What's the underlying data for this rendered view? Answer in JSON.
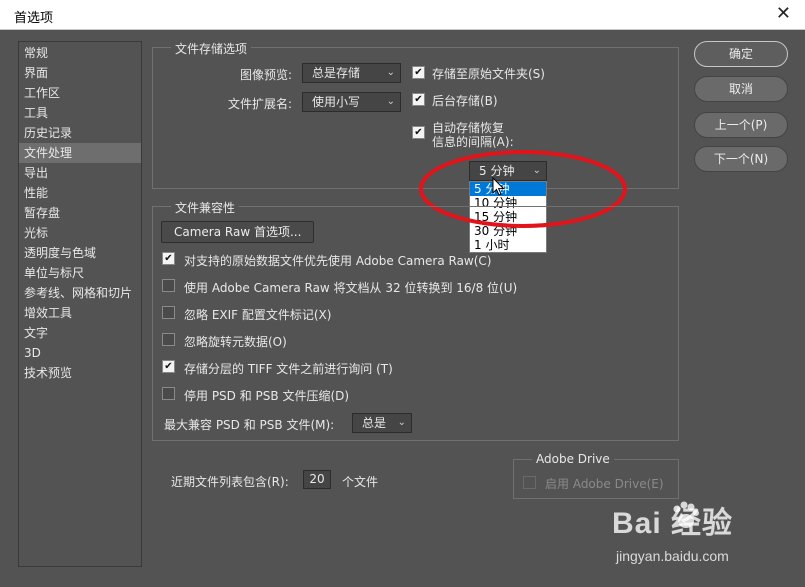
{
  "window": {
    "title": "首选项",
    "close_glyph": "✕"
  },
  "sidebar": {
    "items": [
      {
        "label": "常规"
      },
      {
        "label": "界面"
      },
      {
        "label": "工作区"
      },
      {
        "label": "工具"
      },
      {
        "label": "历史记录"
      },
      {
        "label": "文件处理",
        "active": true
      },
      {
        "label": "导出"
      },
      {
        "label": "性能"
      },
      {
        "label": "暂存盘"
      },
      {
        "label": "光标"
      },
      {
        "label": "透明度与色域"
      },
      {
        "label": "单位与标尺"
      },
      {
        "label": "参考线、网格和切片"
      },
      {
        "label": "增效工具"
      },
      {
        "label": "文字"
      },
      {
        "label": "3D"
      },
      {
        "label": "技术预览"
      }
    ]
  },
  "file_saving": {
    "title": "文件存储选项",
    "image_preview_label": "图像预览:",
    "image_preview_value": "总是存储",
    "file_ext_label": "文件扩展名:",
    "file_ext_value": "使用小写",
    "save_to_original": {
      "label": "存储至原始文件夹(S)",
      "checked": true
    },
    "background_save": {
      "label": "后台存储(B)",
      "checked": true
    },
    "autosave": {
      "label_line1": "自动存储恢复",
      "label_line2": "信息的间隔(A):",
      "checked": true
    },
    "interval_value": "5 分钟",
    "interval_options": [
      "5 分钟",
      "10 分钟",
      "15 分钟",
      "30 分钟",
      "1 小时"
    ]
  },
  "compat": {
    "title": "文件兼容性",
    "camera_raw_button": "Camera Raw 首选项...",
    "options": [
      {
        "label": "对支持的原始数据文件优先使用 Adobe Camera Raw(C)",
        "checked": true
      },
      {
        "label": "使用 Adobe Camera Raw 将文档从 32 位转换到 16/8 位(U)",
        "checked": false
      },
      {
        "label": "忽略 EXIF 配置文件标记(X)",
        "checked": false
      },
      {
        "label": "忽略旋转元数据(O)",
        "checked": false
      },
      {
        "label": "存储分层的 TIFF 文件之前进行询问 (T)",
        "checked": true
      },
      {
        "label": "停用 PSD 和 PSB 文件压缩(D)",
        "checked": false
      }
    ],
    "max_compat_label": "最大兼容 PSD 和 PSB 文件(M):",
    "max_compat_value": "总是"
  },
  "recent": {
    "label": "近期文件列表包含(R):",
    "value": "20",
    "suffix": "个文件"
  },
  "adobe_drive": {
    "title": "Adobe Drive",
    "option_label": "启用 Adobe Drive(E)",
    "checked": false
  },
  "buttons": {
    "ok": "确定",
    "cancel": "取消",
    "prev": "上一个(P)",
    "next": "下一个(N)"
  },
  "watermark": {
    "brand": "Bai 经验",
    "url": "jingyan.baidu.com"
  },
  "colors": {
    "accent": "#0078d7",
    "annotation_ring": "#e0141a",
    "dialog_bg": "#535353"
  },
  "icons": {
    "close": "close-icon",
    "chevron": "chevron-down-icon",
    "check": "checkmark-icon",
    "pointer": "mouse-pointer-icon",
    "paw": "baidu-paw-icon"
  }
}
